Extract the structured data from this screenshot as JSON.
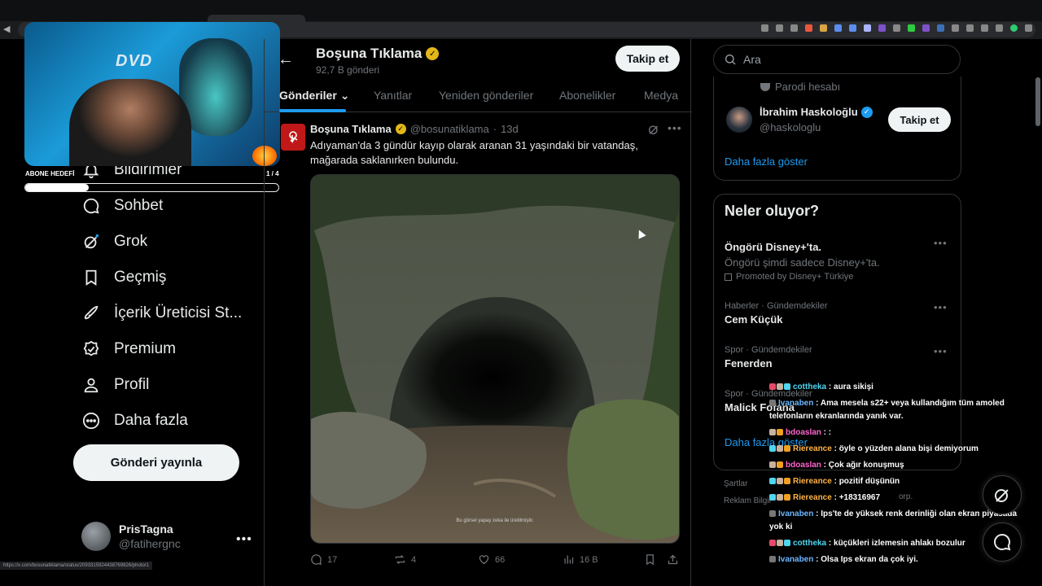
{
  "header": {
    "title": "Boşuna Tıklama",
    "posts_count": "92,7 B gönderi",
    "follow_label": "Takip et"
  },
  "tabs": [
    "Gönderiler",
    "Yanıtlar",
    "Yeniden gönderiler",
    "Abonelikler",
    "Medya"
  ],
  "sidebar": {
    "items": [
      {
        "label": "Bildirimler",
        "icon": "bell-icon"
      },
      {
        "label": "Sohbet",
        "icon": "chat-icon"
      },
      {
        "label": "Grok",
        "icon": "grok-icon"
      },
      {
        "label": "Geçmiş",
        "icon": "bookmark-icon"
      },
      {
        "label": "İçerik Üreticisi St...",
        "icon": "rocket-icon"
      },
      {
        "label": "Premium",
        "icon": "verified-icon"
      },
      {
        "label": "Profil",
        "icon": "person-icon"
      },
      {
        "label": "Daha fazla",
        "icon": "more-circle-icon"
      }
    ],
    "post_button": "Gönderi yayınla",
    "user": {
      "name": "PrisTagna",
      "handle": "@fatihergnc"
    }
  },
  "stream_overlay": {
    "goal_label": "ABONE HEDEFİ",
    "goal_count": "1 / 4",
    "goal_progress": 0.25,
    "logo_text": "DVD"
  },
  "tweet": {
    "author": "Boşuna Tıklama",
    "handle": "@bosunatiklama",
    "time": "13d",
    "text": "Adıyaman'da 3 gündür kayıp olarak aranan 31 yaşındaki bir vatandaş, mağarada saklanırken bulundu.",
    "image_note": "Bu görsel yapay zeka ile üretilmiştir.",
    "stats": {
      "replies": "17",
      "reposts": "4",
      "likes": "66",
      "views": "16 B"
    }
  },
  "right": {
    "search_placeholder": "Ara",
    "parody_label": "Parodi hesabı",
    "suggestion": {
      "name": "İbrahim Haskoloğlu",
      "handle": "@haskologlu",
      "follow_label": "Takip et"
    },
    "show_more": "Daha fazla göster",
    "trends_title": "Neler oluyor?",
    "trends": [
      {
        "category": "",
        "name": "Öngörü Disney+'ta.",
        "subtitle": "Öngörü şimdi sadece Disney+'ta.",
        "promoted": "Promoted by Disney+ Türkiye"
      },
      {
        "category": "Haberler · Gündemdekiler",
        "name": "Cem Küçük"
      },
      {
        "category": "Spor · Gündemdekiler",
        "name": "Fenerden"
      },
      {
        "category": "Spor · Gündemdekiler",
        "name": "Malick Fofana"
      }
    ],
    "trends_show_more": "Daha fazla göster",
    "footer": [
      "Şartlar",
      "Reklam Bilgil",
      "orp."
    ]
  },
  "chat": [
    {
      "user": "cottheka",
      "color": "#4fd6f0",
      "text": "aura sikişi",
      "badges": [
        "#e8496a",
        "#c9b2a0",
        "#4fd6f0"
      ]
    },
    {
      "user": "Ivanaben",
      "color": "#6cb6ff",
      "text": "Ama mesela s22+ veya kullandığım tüm amoled telefonların ekranlarında yanık var.",
      "badges": [
        "#777"
      ]
    },
    {
      "user": "bdoaslan",
      "color": "#ff66cc",
      "text": ":",
      "badges": [
        "#c9b2a0",
        "#f0a020"
      ]
    },
    {
      "user": "Riereance",
      "color": "#ffb347",
      "text": "öyle o yüzden alana bişi demiyorum",
      "badges": [
        "#4fd6f0",
        "#c9b2a0",
        "#f0a020"
      ]
    },
    {
      "user": "bdoaslan",
      "color": "#ff66cc",
      "text": "Çok ağır konuşmuş",
      "badges": [
        "#c9b2a0",
        "#f0a020"
      ]
    },
    {
      "user": "Riereance",
      "color": "#ffb347",
      "text": "pozitif düşünün",
      "badges": [
        "#4fd6f0",
        "#c9b2a0",
        "#f0a020"
      ]
    },
    {
      "user": "Riereance",
      "color": "#ffb347",
      "text": "+18316967",
      "badges": [
        "#4fd6f0",
        "#c9b2a0",
        "#f0a020"
      ]
    },
    {
      "user": "Ivanaben",
      "color": "#6cb6ff",
      "text": "Ips'te de yüksek renk derinliği olan ekran piyasada yok ki",
      "badges": [
        "#777"
      ]
    },
    {
      "user": "cottheka",
      "color": "#4fd6f0",
      "text": "küçükleri izlemesin ahlakı bozulur",
      "badges": [
        "#e8496a",
        "#c9b2a0",
        "#4fd6f0"
      ]
    },
    {
      "user": "Ivanaben",
      "color": "#6cb6ff",
      "text": "Olsa Ips ekran da çok iyi.",
      "badges": [
        "#777"
      ]
    }
  ],
  "status_url": "https://x.com/bosunatiklama/status/2093315924438769826/photo/1",
  "colors": {
    "accent": "#1d9bf0",
    "gold": "#e2b719",
    "background": "#000000"
  }
}
